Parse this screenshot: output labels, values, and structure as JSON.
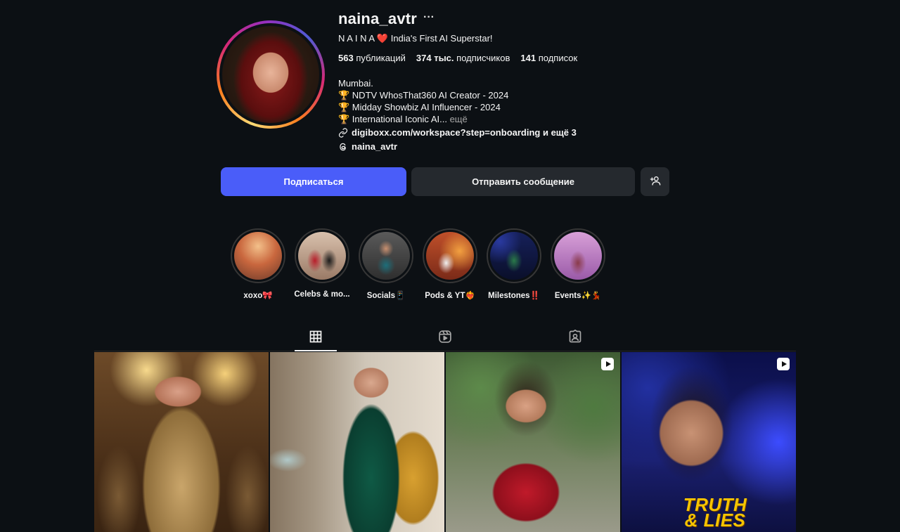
{
  "profile": {
    "username": "naina_avtr",
    "more_icon": "more-horizontal-icon",
    "tagline": "N A I N A ❤️ India's First AI Superstar!",
    "stats": {
      "posts_count": "563",
      "posts_label": "публикаций",
      "followers_count": "374 тыс.",
      "followers_label": "подписчиков",
      "following_count": "141",
      "following_label": "подписок"
    },
    "bio": {
      "line1": "Mumbai.",
      "line2": "🏆 NDTV WhosThat360 AI Creator - 2024",
      "line3": "🏆 Midday Showbiz AI Influencer - 2024",
      "line4": "🏆 International Iconic AI...",
      "more": "ещё"
    },
    "link": "digiboxx.com/workspace?step=onboarding и ещё 3",
    "threads_handle": "naina_avtr",
    "avatar_ring_colors": [
      "#feda75",
      "#fa7e1e",
      "#d62976",
      "#962fbf",
      "#4f5bd5"
    ]
  },
  "actions": {
    "follow_label": "Подписаться",
    "message_label": "Отправить сообщение",
    "add_icon": "add-person-icon",
    "follow_color": "#4a5df9"
  },
  "highlights": [
    {
      "label": "xoxo🎀"
    },
    {
      "label": "Celebs & mo..."
    },
    {
      "label": "Socials📱"
    },
    {
      "label": "Pods & YT❤️‍🔥"
    },
    {
      "label": "Milestones‼️"
    },
    {
      "label": "Events✨💃"
    }
  ],
  "tabs": [
    {
      "icon": "grid-icon",
      "active": true
    },
    {
      "icon": "reels-icon",
      "active": false
    },
    {
      "icon": "tagged-icon",
      "active": false
    }
  ],
  "posts": [
    {
      "type": "image"
    },
    {
      "type": "image"
    },
    {
      "type": "reel",
      "icon": "reel-icon"
    },
    {
      "type": "reel",
      "icon": "reel-icon",
      "title": "TRUTH & LIES"
    }
  ]
}
